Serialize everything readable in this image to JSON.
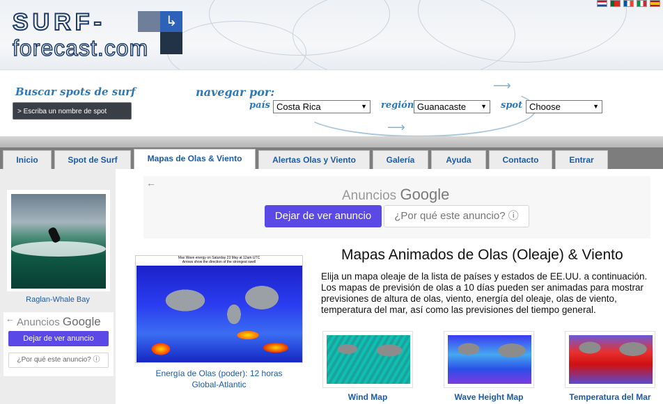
{
  "header": {
    "logo_top": "SURF-",
    "logo_bottom": "forecast.com",
    "flags": [
      "nl-flag",
      "pt-flag",
      "fr-flag",
      "it-flag",
      "es-flag"
    ]
  },
  "search": {
    "title": "Buscar spots de surf",
    "placeholder": "> Escriba un nombre de spot"
  },
  "navigate": {
    "title": "navegar por:",
    "pais_label": "país",
    "pais_value": "Costa Rica",
    "region_label": "región",
    "region_value": "Guanacaste",
    "spot_label": "spot",
    "spot_value": "Choose"
  },
  "tabs": [
    {
      "label": "Inicio"
    },
    {
      "label": "Spot de Surf"
    },
    {
      "label": "Mapas de Olas & Viento"
    },
    {
      "label": "Alertas Olas y Viento"
    },
    {
      "label": "Galería"
    },
    {
      "label": "Ayuda"
    },
    {
      "label": "Contacto"
    },
    {
      "label": "Entrar"
    }
  ],
  "sidebar": {
    "spot_caption": "Raglan-Whale Bay",
    "ad": {
      "brand_prefix": "Anuncios",
      "brand": "Google",
      "stop_label": "Dejar de ver anuncio",
      "why_label": "¿Por qué este anuncio? ⓘ"
    }
  },
  "top_ad": {
    "brand_prefix": "Anuncios",
    "brand": "Google",
    "stop_label": "Dejar de ver anuncio",
    "why_label": "¿Por qué este anuncio? ⓘ"
  },
  "map": {
    "image_title": "Max Wave energy on Saturday 23 May at 12am UTC",
    "image_subtitle": "Arrows show the direction of the strongest swell",
    "caption_line1": "Energía de Olas (poder): 12 horas",
    "caption_line2": "Global-Atlantic"
  },
  "content": {
    "heading": "Mapas Animados de Olas (Oleaje) & Viento",
    "paragraph": "Elija un mapa oleaje de la lista de países y estados de EE.UU. a continuación. Los mapas de previsión de olas a 10 días pueden ser animadas para mostrar previsiones de altura de olas, viento, energía del oleaje, olas de viento, temperatura del mar, así como las previsiones del tiempo general."
  },
  "thumbnails": [
    {
      "label": "Wind Map"
    },
    {
      "label": "Wave Height Map"
    },
    {
      "label": "Temperatura del Mar"
    }
  ]
}
